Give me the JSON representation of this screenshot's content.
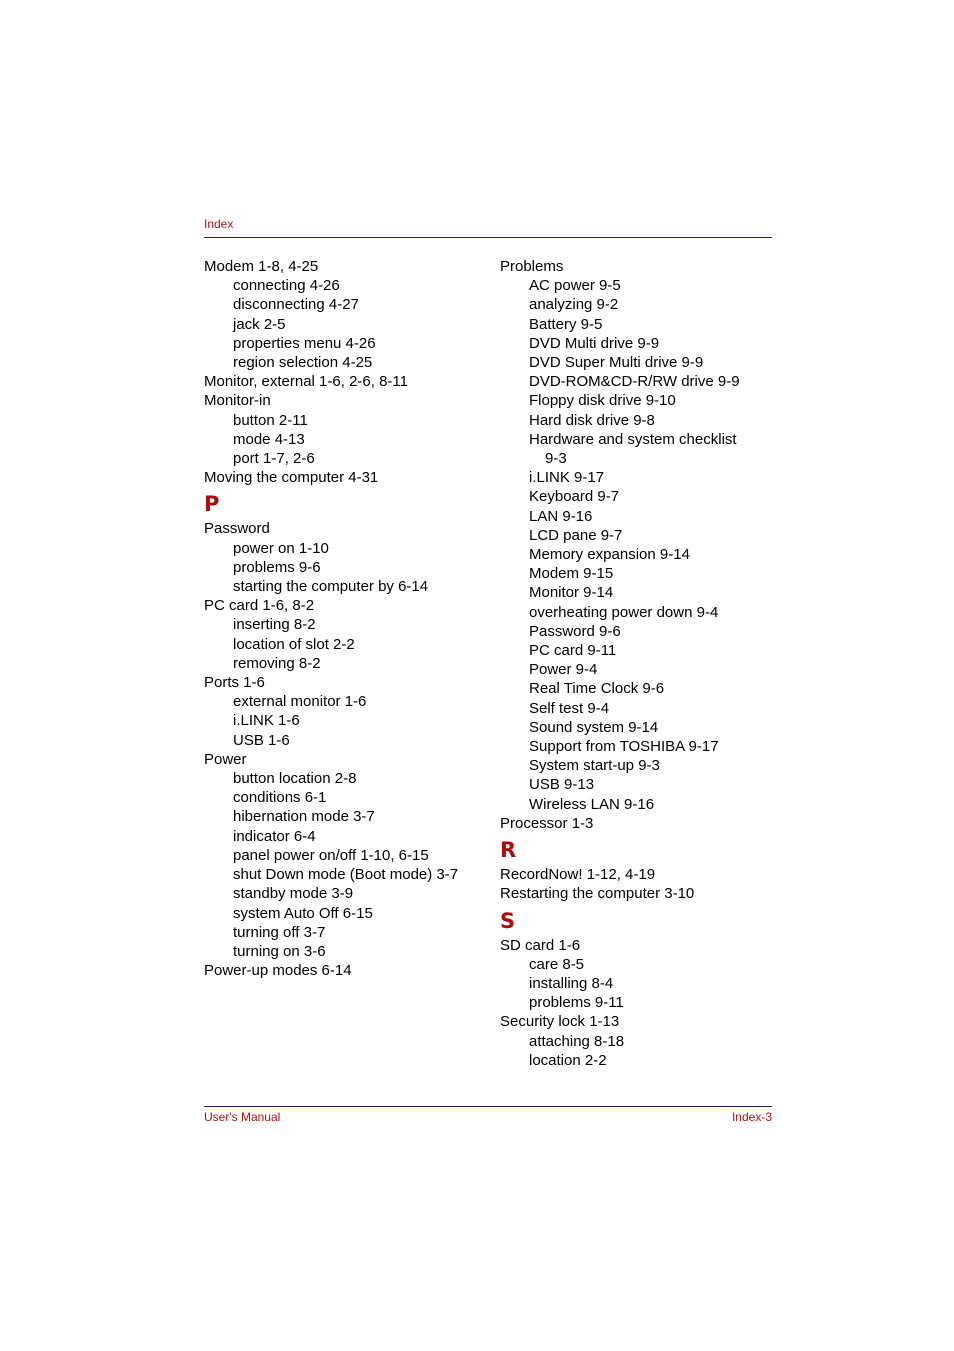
{
  "header": {
    "label": "Index"
  },
  "footer": {
    "left": "User's Manual",
    "right": "Index-3"
  },
  "colors": {
    "accent_red": "#b01010",
    "rule_navy": "#1a1a6e"
  },
  "left_column": [
    {
      "type": "main",
      "text": "Modem 1-8, 4-25"
    },
    {
      "type": "sub",
      "text": "connecting 4-26"
    },
    {
      "type": "sub",
      "text": "disconnecting 4-27"
    },
    {
      "type": "sub",
      "text": "jack 2-5"
    },
    {
      "type": "sub",
      "text": "properties menu 4-26"
    },
    {
      "type": "sub",
      "text": "region selection 4-25"
    },
    {
      "type": "main",
      "text": "Monitor, external 1-6, 2-6, 8-11"
    },
    {
      "type": "main",
      "text": "Monitor-in"
    },
    {
      "type": "sub",
      "text": "button 2-11"
    },
    {
      "type": "sub",
      "text": "mode 4-13"
    },
    {
      "type": "sub",
      "text": "port 1-7, 2-6"
    },
    {
      "type": "main",
      "text": "Moving the computer 4-31"
    },
    {
      "type": "letter",
      "text": "P"
    },
    {
      "type": "main",
      "text": "Password"
    },
    {
      "type": "sub",
      "text": "power on 1-10"
    },
    {
      "type": "sub",
      "text": "problems 9-6"
    },
    {
      "type": "sub",
      "text": "starting the computer by 6-14"
    },
    {
      "type": "main",
      "text": "PC card 1-6, 8-2"
    },
    {
      "type": "sub",
      "text": "inserting 8-2"
    },
    {
      "type": "sub",
      "text": "location of slot 2-2"
    },
    {
      "type": "sub",
      "text": "removing 8-2"
    },
    {
      "type": "main",
      "text": "Ports 1-6"
    },
    {
      "type": "sub",
      "text": "external monitor 1-6"
    },
    {
      "type": "sub",
      "text": "i.LINK 1-6"
    },
    {
      "type": "sub",
      "text": "USB 1-6"
    },
    {
      "type": "main",
      "text": "Power"
    },
    {
      "type": "sub",
      "text": "button location 2-8"
    },
    {
      "type": "sub",
      "text": "conditions 6-1"
    },
    {
      "type": "sub",
      "text": "hibernation mode 3-7"
    },
    {
      "type": "sub",
      "text": "indicator 6-4"
    },
    {
      "type": "sub",
      "text": "panel power on/off 1-10, 6-15"
    },
    {
      "type": "sub",
      "text": "shut Down mode (Boot mode) 3-7"
    },
    {
      "type": "sub",
      "text": "standby mode 3-9"
    },
    {
      "type": "sub",
      "text": "system Auto Off 6-15"
    },
    {
      "type": "sub",
      "text": "turning off 3-7"
    },
    {
      "type": "sub",
      "text": "turning on 3-6"
    },
    {
      "type": "main",
      "text": "Power-up modes 6-14"
    }
  ],
  "right_column": [
    {
      "type": "main",
      "text": "Problems"
    },
    {
      "type": "sub",
      "text": "AC power 9-5"
    },
    {
      "type": "sub",
      "text": "analyzing 9-2"
    },
    {
      "type": "sub",
      "text": "Battery 9-5"
    },
    {
      "type": "sub",
      "text": "DVD Multi drive 9-9"
    },
    {
      "type": "sub",
      "text": "DVD Super Multi drive 9-9"
    },
    {
      "type": "sub",
      "text": "DVD-ROM&CD-R/RW drive 9-9"
    },
    {
      "type": "sub",
      "text": "Floppy disk drive 9-10"
    },
    {
      "type": "sub",
      "text": "Hard disk drive 9-8"
    },
    {
      "type": "sub",
      "text": "Hardware and system checklist"
    },
    {
      "type": "cont",
      "text": "9-3"
    },
    {
      "type": "sub",
      "text": "i.LINK 9-17"
    },
    {
      "type": "sub",
      "text": "Keyboard 9-7"
    },
    {
      "type": "sub",
      "text": "LAN 9-16"
    },
    {
      "type": "sub",
      "text": "LCD pane 9-7"
    },
    {
      "type": "sub",
      "text": "Memory expansion 9-14"
    },
    {
      "type": "sub",
      "text": "Modem 9-15"
    },
    {
      "type": "sub",
      "text": "Monitor 9-14"
    },
    {
      "type": "sub",
      "text": "overheating power down 9-4"
    },
    {
      "type": "sub",
      "text": "Password 9-6"
    },
    {
      "type": "sub",
      "text": "PC card 9-11"
    },
    {
      "type": "sub",
      "text": "Power 9-4"
    },
    {
      "type": "sub",
      "text": "Real Time Clock 9-6"
    },
    {
      "type": "sub",
      "text": "Self test 9-4"
    },
    {
      "type": "sub",
      "text": "Sound system 9-14"
    },
    {
      "type": "sub",
      "text": "Support from TOSHIBA 9-17"
    },
    {
      "type": "sub",
      "text": "System start-up 9-3"
    },
    {
      "type": "sub",
      "text": "USB 9-13"
    },
    {
      "type": "sub",
      "text": "Wireless LAN 9-16"
    },
    {
      "type": "main",
      "text": "Processor 1-3"
    },
    {
      "type": "letter",
      "text": "R"
    },
    {
      "type": "main",
      "text": "RecordNow! 1-12, 4-19"
    },
    {
      "type": "main",
      "text": "Restarting the computer 3-10"
    },
    {
      "type": "letter",
      "text": "S"
    },
    {
      "type": "main",
      "text": "SD card 1-6"
    },
    {
      "type": "sub",
      "text": "care 8-5"
    },
    {
      "type": "sub",
      "text": "installing 8-4"
    },
    {
      "type": "sub",
      "text": "problems 9-11"
    },
    {
      "type": "main",
      "text": "Security lock 1-13"
    },
    {
      "type": "sub",
      "text": "attaching 8-18"
    },
    {
      "type": "sub",
      "text": "location 2-2"
    }
  ]
}
